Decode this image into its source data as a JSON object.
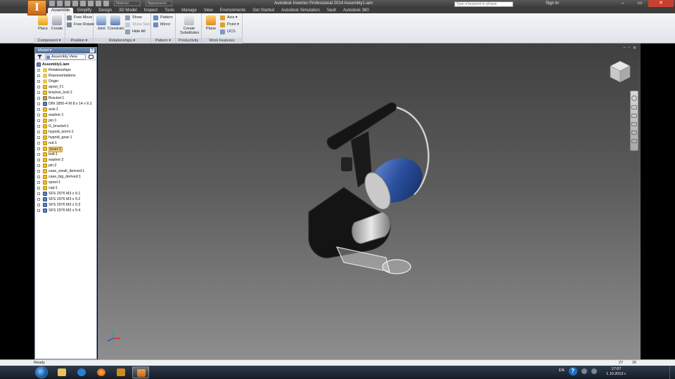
{
  "titlebar": {
    "app_logo": "I",
    "material": "Material",
    "appearance": "Appearance",
    "title": "Autodesk Inventor Professional 2014    Assembly1.iam",
    "search_placeholder": "Type a keyword or phrase",
    "signin": "Sign In",
    "window_controls": [
      "–",
      "▭",
      "✕"
    ]
  },
  "tabs": [
    "Assemble",
    "Simplify",
    "Design",
    "3D Model",
    "Inspect",
    "Tools",
    "Manage",
    "View",
    "Environments",
    "Get Started",
    "Autodesk Simulation",
    "Vault",
    "Autodesk 360"
  ],
  "ribbon": {
    "component": {
      "label": "Component ▾",
      "place": "Place",
      "create": "Create"
    },
    "position": {
      "label": "Position ▾",
      "free_move": "Free Move",
      "free_rotate": "Free Rotate"
    },
    "relationships": {
      "label": "Relationships ▾",
      "joint": "Joint",
      "constrain": "Constrain",
      "show": "Show",
      "show_sick": "Show Sick",
      "hide_all": "Hide All"
    },
    "pattern": {
      "label": "Pattern ▾",
      "pattern": "Pattern",
      "mirror": "Mirror"
    },
    "productivity": {
      "label": "Productivity",
      "create_substitutes": "Create Substitutes"
    },
    "work_features": {
      "label": "Work Features",
      "plane": "Plane",
      "axis": "Axis ▾",
      "point": "Point ▾",
      "ucs": "UCS"
    }
  },
  "browser": {
    "title": "Model ▾",
    "close": "?",
    "view": "Assembly View",
    "root": "Assembly1.iam",
    "items": [
      {
        "label": "Relationships",
        "icon": "folder",
        "exp": true
      },
      {
        "label": "Representations",
        "icon": "folder",
        "exp": true
      },
      {
        "label": "Origin",
        "icon": "folder",
        "exp": true
      },
      {
        "label": "spool_f:1",
        "icon": "part",
        "exp": true
      },
      {
        "label": "bracket_lock:1",
        "icon": "part",
        "exp": true
      },
      {
        "label": "Bracket:1",
        "icon": "sub",
        "exp": true
      },
      {
        "label": "DIN 1850-4 M 8 x 14 x 6:1",
        "icon": "std",
        "exp": true
      },
      {
        "label": "axis:1",
        "icon": "part",
        "exp": true
      },
      {
        "label": "washer:1",
        "icon": "part",
        "exp": true
      },
      {
        "label": "pin:1",
        "icon": "part",
        "exp": true
      },
      {
        "label": "G_bracket:1",
        "icon": "part",
        "exp": true
      },
      {
        "label": "hypoid_worm:1",
        "icon": "part",
        "exp": true
      },
      {
        "label": "hypoid_gear:1",
        "icon": "part",
        "exp": true
      },
      {
        "label": "nut:1",
        "icon": "part",
        "exp": true
      },
      {
        "label": "lever:1",
        "icon": "part",
        "exp": true,
        "selected": true
      },
      {
        "label": "bolt:1",
        "icon": "part",
        "exp": true
      },
      {
        "label": "washer:2",
        "icon": "part",
        "exp": true
      },
      {
        "label": "pin:2",
        "icon": "part",
        "exp": true
      },
      {
        "label": "case_small_derived:1",
        "icon": "part",
        "exp": true
      },
      {
        "label": "case_big_derived:1",
        "icon": "part",
        "exp": true
      },
      {
        "label": "spool:1",
        "icon": "part",
        "exp": true
      },
      {
        "label": "cap:1",
        "icon": "part",
        "exp": true
      },
      {
        "label": "SFS 2976 M3 x 5:1",
        "icon": "std",
        "exp": true
      },
      {
        "label": "SFS 2976 M3 x 5:2",
        "icon": "std",
        "exp": true
      },
      {
        "label": "SFS 2976 M3 x 5:3",
        "icon": "std",
        "exp": true
      },
      {
        "label": "SFS 2976 M3 x 5:4",
        "icon": "std",
        "exp": true
      }
    ]
  },
  "viewport": {
    "controls": [
      "–",
      "▫",
      "✕"
    ]
  },
  "status": {
    "text": "Ready",
    "n1": "27",
    "n2": "25"
  },
  "taskbar": {
    "lang": "EN",
    "time": "17:07",
    "date": "1.10.2013 г."
  },
  "colors": {
    "accent": "#e37a1e",
    "status_close": "#c7412f",
    "selection": "#f5d070",
    "browser_head": "#4a6a94"
  }
}
